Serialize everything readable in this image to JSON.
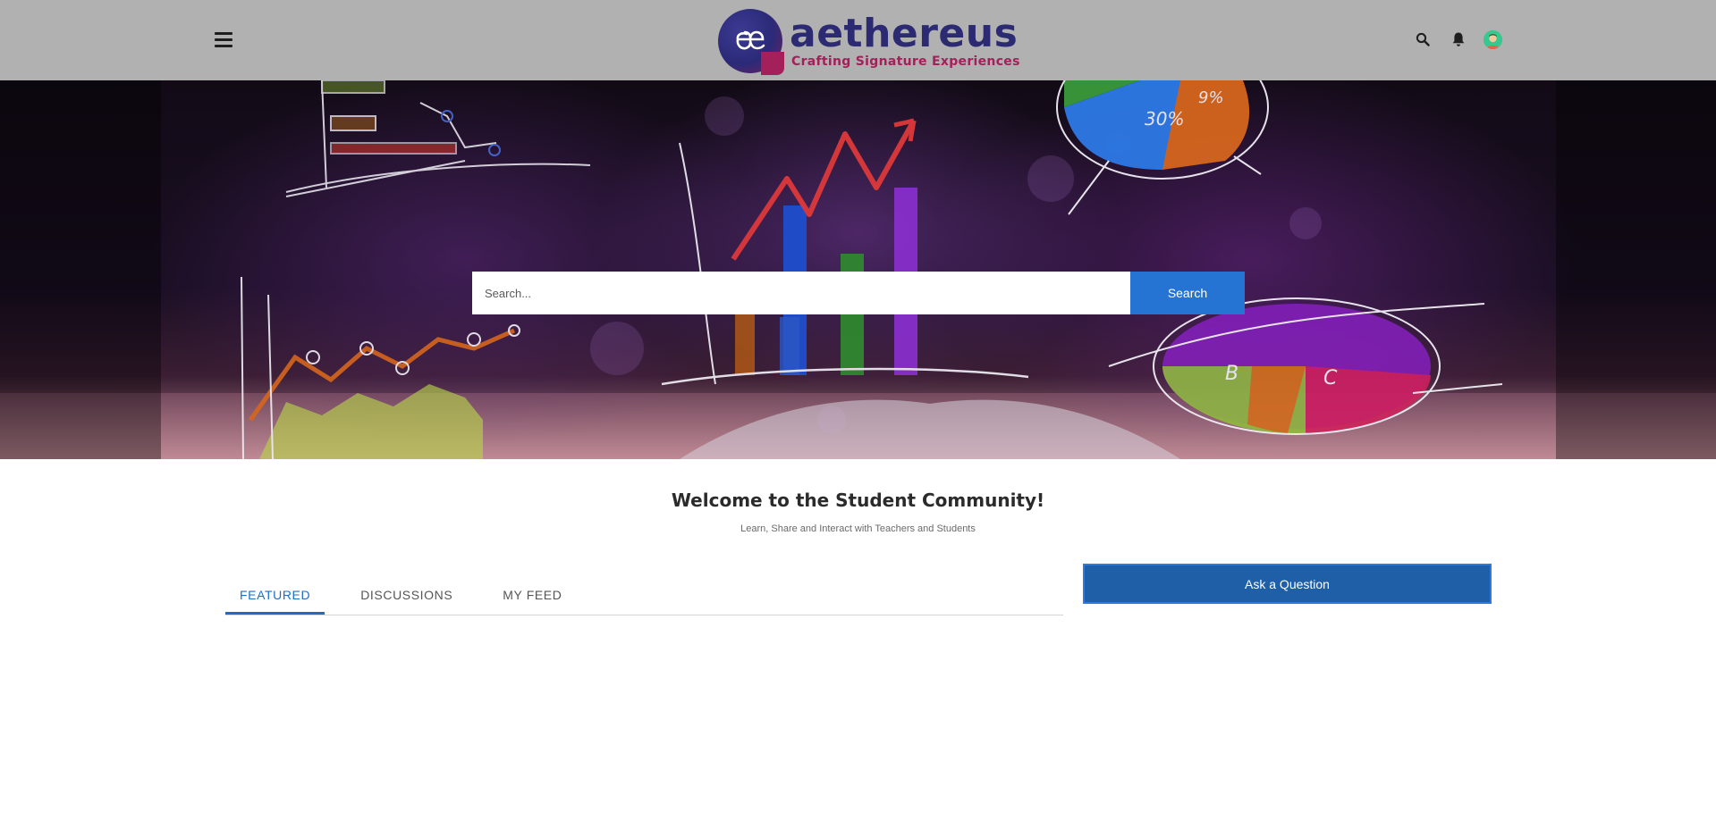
{
  "header": {
    "brand_name": "aethereus",
    "brand_tagline": "Crafting Signature Experiences",
    "icons": [
      "menu-icon",
      "search-icon",
      "bell-icon",
      "user-avatar"
    ]
  },
  "hero": {
    "search_placeholder": "Search...",
    "search_button_label": "Search"
  },
  "welcome": {
    "title": "Welcome to the Student Community!",
    "subtitle": "Learn, Share and Interact with Teachers and Students"
  },
  "tabs": [
    {
      "label": "FEATURED",
      "active": true
    },
    {
      "label": "DISCUSSIONS",
      "active": false
    },
    {
      "label": "MY FEED",
      "active": false
    }
  ],
  "actions": {
    "ask_question_label": "Ask a Question"
  },
  "colors": {
    "header_bg": "#b1b1b1",
    "brand_primary": "#2b2a72",
    "brand_accent": "#a3205b",
    "search_button": "#2574d3",
    "active_tab": "#1f6dc2",
    "ask_button": "#1f5fa8"
  }
}
